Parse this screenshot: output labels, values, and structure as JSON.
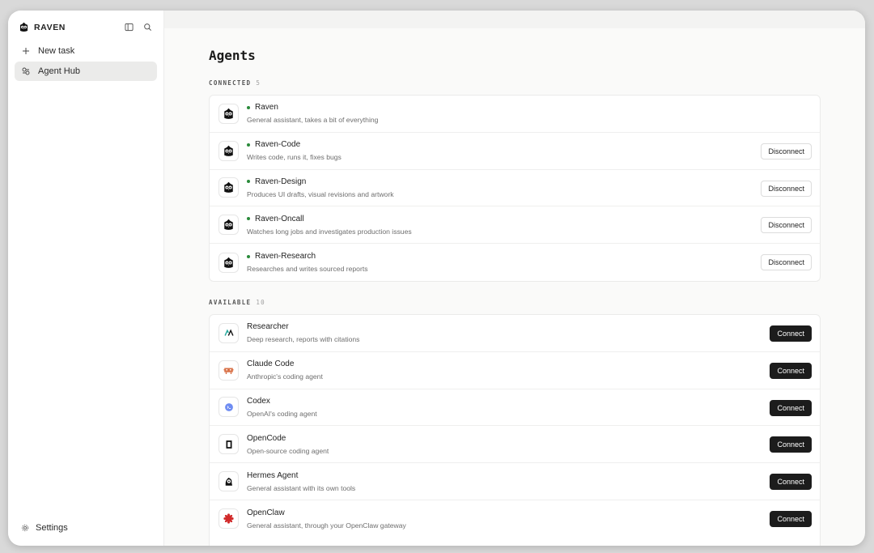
{
  "app": {
    "name": "RAVEN"
  },
  "sidebar": {
    "items": [
      {
        "label": "New task",
        "icon": "plus-icon"
      },
      {
        "label": "Agent Hub",
        "icon": "agent-hub-icon"
      }
    ],
    "settings_label": "Settings"
  },
  "page": {
    "title": "Agents",
    "connected": {
      "label": "CONNECTED",
      "count": "5",
      "agents": [
        {
          "name": "Raven",
          "desc": "General assistant, takes a bit of everything",
          "button": ""
        },
        {
          "name": "Raven-Code",
          "desc": "Writes code, runs it, fixes bugs",
          "button": "Disconnect"
        },
        {
          "name": "Raven-Design",
          "desc": "Produces UI drafts, visual revisions and artwork",
          "button": "Disconnect"
        },
        {
          "name": "Raven-Oncall",
          "desc": "Watches long jobs and investigates production issues",
          "button": "Disconnect"
        },
        {
          "name": "Raven-Research",
          "desc": "Researches and writes sourced reports",
          "button": "Disconnect"
        }
      ]
    },
    "available": {
      "label": "AVAILABLE",
      "count": "10",
      "agents": [
        {
          "name": "Researcher",
          "desc": "Deep research, reports with citations",
          "button": "Connect",
          "icon": "researcher-logo-icon"
        },
        {
          "name": "Claude Code",
          "desc": "Anthropic's coding agent",
          "button": "Connect",
          "icon": "claude-code-logo-icon"
        },
        {
          "name": "Codex",
          "desc": "OpenAI's coding agent",
          "button": "Connect",
          "icon": "codex-logo-icon"
        },
        {
          "name": "OpenCode",
          "desc": "Open-source coding agent",
          "button": "Connect",
          "icon": "opencode-logo-icon"
        },
        {
          "name": "Hermes Agent",
          "desc": "General assistant with its own tools",
          "button": "Connect",
          "icon": "hermes-logo-icon"
        },
        {
          "name": "OpenClaw",
          "desc": "General assistant, through your OpenClaw gateway",
          "button": "Connect",
          "icon": "openclaw-logo-icon"
        }
      ]
    }
  },
  "colors": {
    "connected_dot": "#2a8a3a",
    "connect_button": "#1c1c1c"
  }
}
